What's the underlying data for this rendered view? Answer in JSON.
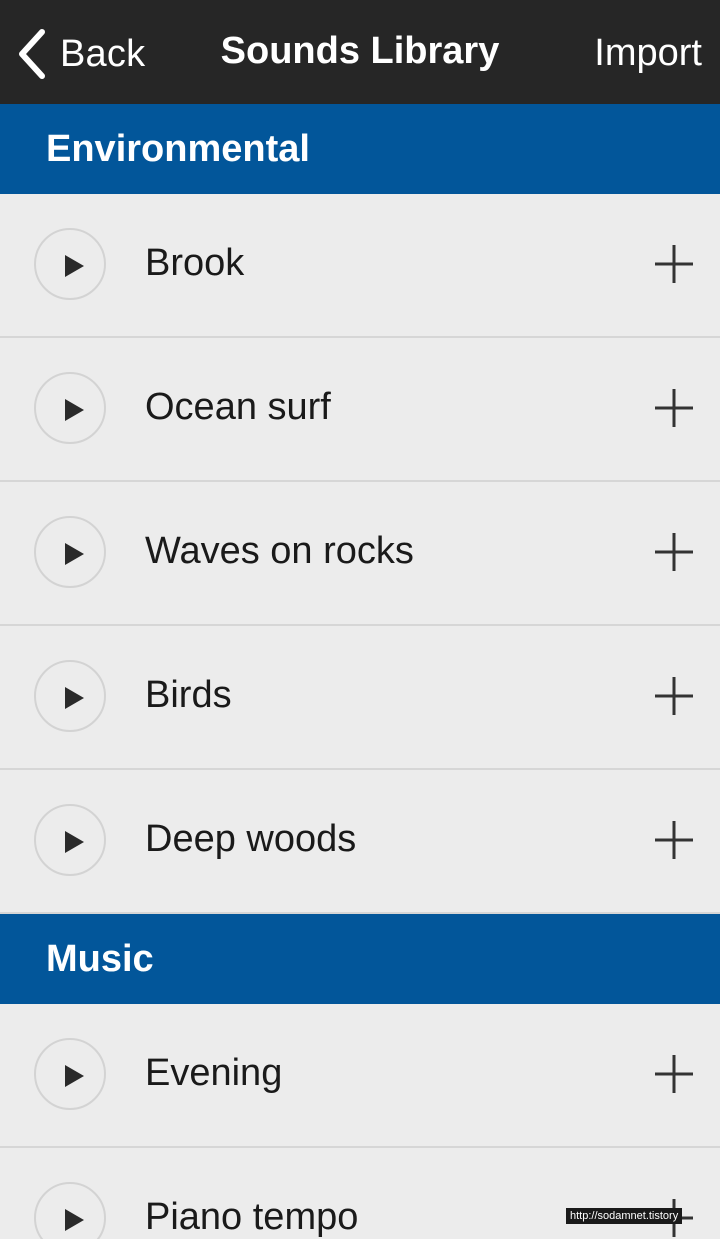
{
  "nav": {
    "back_label": "Back",
    "title": "Sounds Library",
    "import_label": "Import"
  },
  "sections": [
    {
      "title": "Environmental",
      "items": [
        {
          "label": "Brook"
        },
        {
          "label": "Ocean surf"
        },
        {
          "label": "Waves on rocks"
        },
        {
          "label": "Birds"
        },
        {
          "label": "Deep woods"
        }
      ]
    },
    {
      "title": "Music",
      "items": [
        {
          "label": "Evening"
        },
        {
          "label": "Piano tempo"
        }
      ]
    }
  ],
  "watermark": "http://sodamnet.tistory",
  "icons": {
    "back": "chevron-left-icon",
    "play": "play-icon",
    "add": "plus-icon"
  },
  "colors": {
    "nav_bg": "#262626",
    "section_header_bg": "#02569a",
    "row_bg": "#ececec",
    "divider": "#d6d6d6"
  }
}
